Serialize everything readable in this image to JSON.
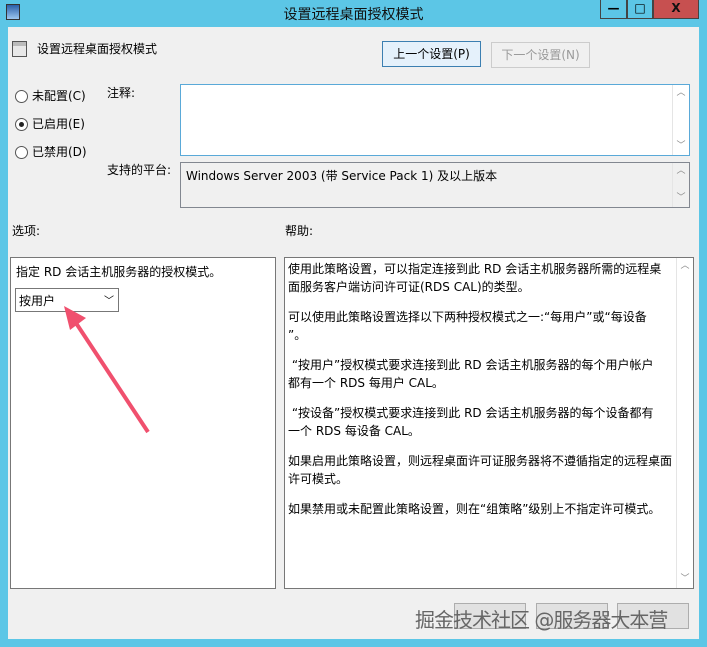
{
  "window": {
    "title": "设置远程桌面授权模式",
    "minimize": "—",
    "maximize": "□",
    "close": "X"
  },
  "header": {
    "setting_name": "设置远程桌面授权模式",
    "prev_button": "上一个设置(P)",
    "next_button": "下一个设置(N)"
  },
  "state": {
    "options": [
      {
        "label": "未配置(C)",
        "selected": false
      },
      {
        "label": "已启用(E)",
        "selected": true
      },
      {
        "label": "已禁用(D)",
        "selected": false
      }
    ]
  },
  "comment": {
    "label": "注释:",
    "value": ""
  },
  "platform": {
    "label": "支持的平台:",
    "value": "Windows Server 2003 (带 Service Pack 1) 及以上版本"
  },
  "options_panel": {
    "label": "选项:",
    "description": "指定 RD 会话主机服务器的授权模式。",
    "select_value": "按用户"
  },
  "help_panel": {
    "label": "帮助:",
    "paragraphs": [
      "使用此策略设置，可以指定连接到此 RD 会话主机服务器所需的远程桌\n面服务客户端访问许可证(RDS CAL)的类型。",
      "可以使用此策略设置选择以下两种授权模式之一:“每用户”或“每设备\n”。",
      " “按用户”授权模式要求连接到此 RD 会话主机服务器的每个用户帐户\n都有一个 RDS 每用户 CAL。",
      " “按设备”授权模式要求连接到此 RD 会话主机服务器的每个设备都有\n一个 RDS 每设备 CAL。",
      "如果启用此策略设置，则远程桌面许可证服务器将不遵循指定的远程桌面\n许可模式。",
      "如果禁用或未配置此策略设置，则在“组策略”级别上不指定许可模式。"
    ]
  },
  "watermark": "掘金技术社区 @服务器大本营",
  "colors": {
    "titlebar": "#5cc6e6",
    "close": "#c75050",
    "arrow": "#f0506e"
  }
}
